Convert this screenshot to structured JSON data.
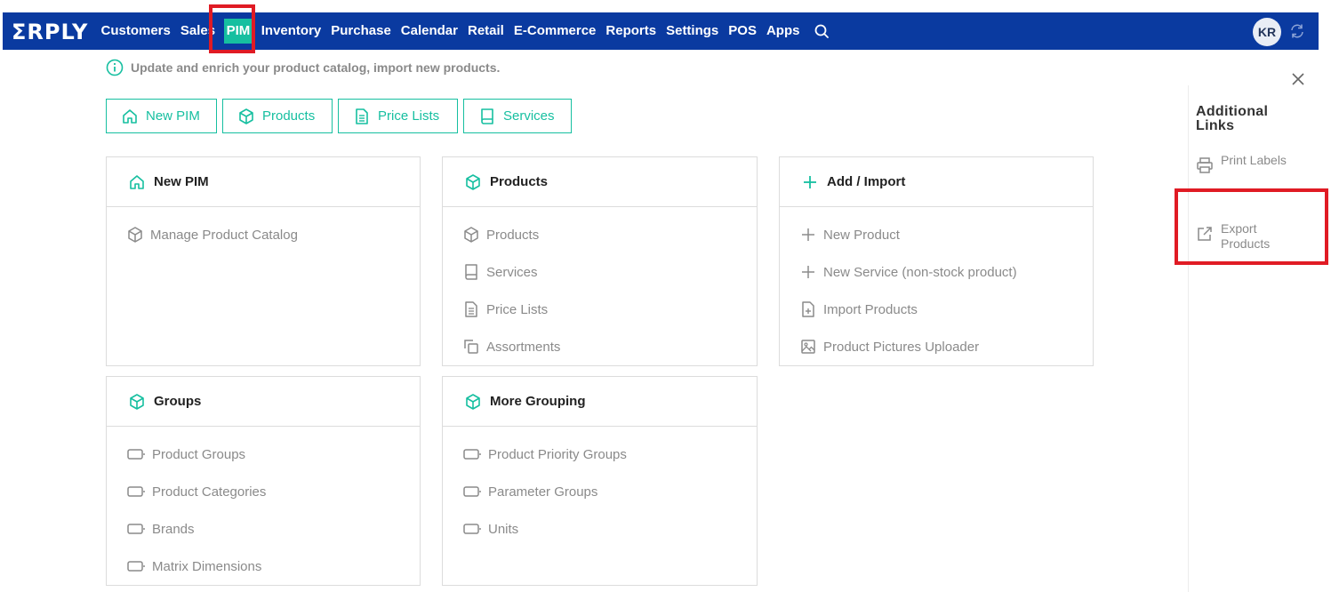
{
  "app": {
    "logo": "ΣRPLY",
    "nav": [
      "Customers",
      "Sales",
      "PIM",
      "Inventory",
      "Purchase",
      "Calendar",
      "Retail",
      "E-Commerce",
      "Reports",
      "Settings",
      "POS",
      "Apps"
    ],
    "active_nav": "PIM",
    "avatar_initials": "KR"
  },
  "info_text": "Update and enrich your product catalog, import new products.",
  "tabs": [
    {
      "label": "New PIM",
      "icon": "home-icon"
    },
    {
      "label": "Products",
      "icon": "box-icon"
    },
    {
      "label": "Price Lists",
      "icon": "document-icon"
    },
    {
      "label": "Services",
      "icon": "book-icon"
    }
  ],
  "cards": {
    "new_pim": {
      "title": "New PIM",
      "items": [
        "Manage Product Catalog"
      ]
    },
    "products": {
      "title": "Products",
      "items": [
        "Products",
        "Services",
        "Price Lists",
        "Assortments"
      ]
    },
    "add_import": {
      "title": "Add / Import",
      "items": [
        "New Product",
        "New Service (non-stock product)",
        "Import Products",
        "Product Pictures Uploader"
      ]
    },
    "groups": {
      "title": "Groups",
      "items": [
        "Product Groups",
        "Product Categories",
        "Brands",
        "Matrix Dimensions"
      ]
    },
    "more_grouping": {
      "title": "More Grouping",
      "items": [
        "Product Priority Groups",
        "Parameter Groups",
        "Units"
      ]
    }
  },
  "sidebar": {
    "title": "Additional Links",
    "links": [
      {
        "label": "Print Labels",
        "icon": "printer-icon"
      },
      {
        "label": "Export Products",
        "icon": "external-link-icon"
      }
    ]
  },
  "colors": {
    "nav_bg": "#0a3aa0",
    "accent": "#16bfa0",
    "highlight": "#e01b24"
  }
}
